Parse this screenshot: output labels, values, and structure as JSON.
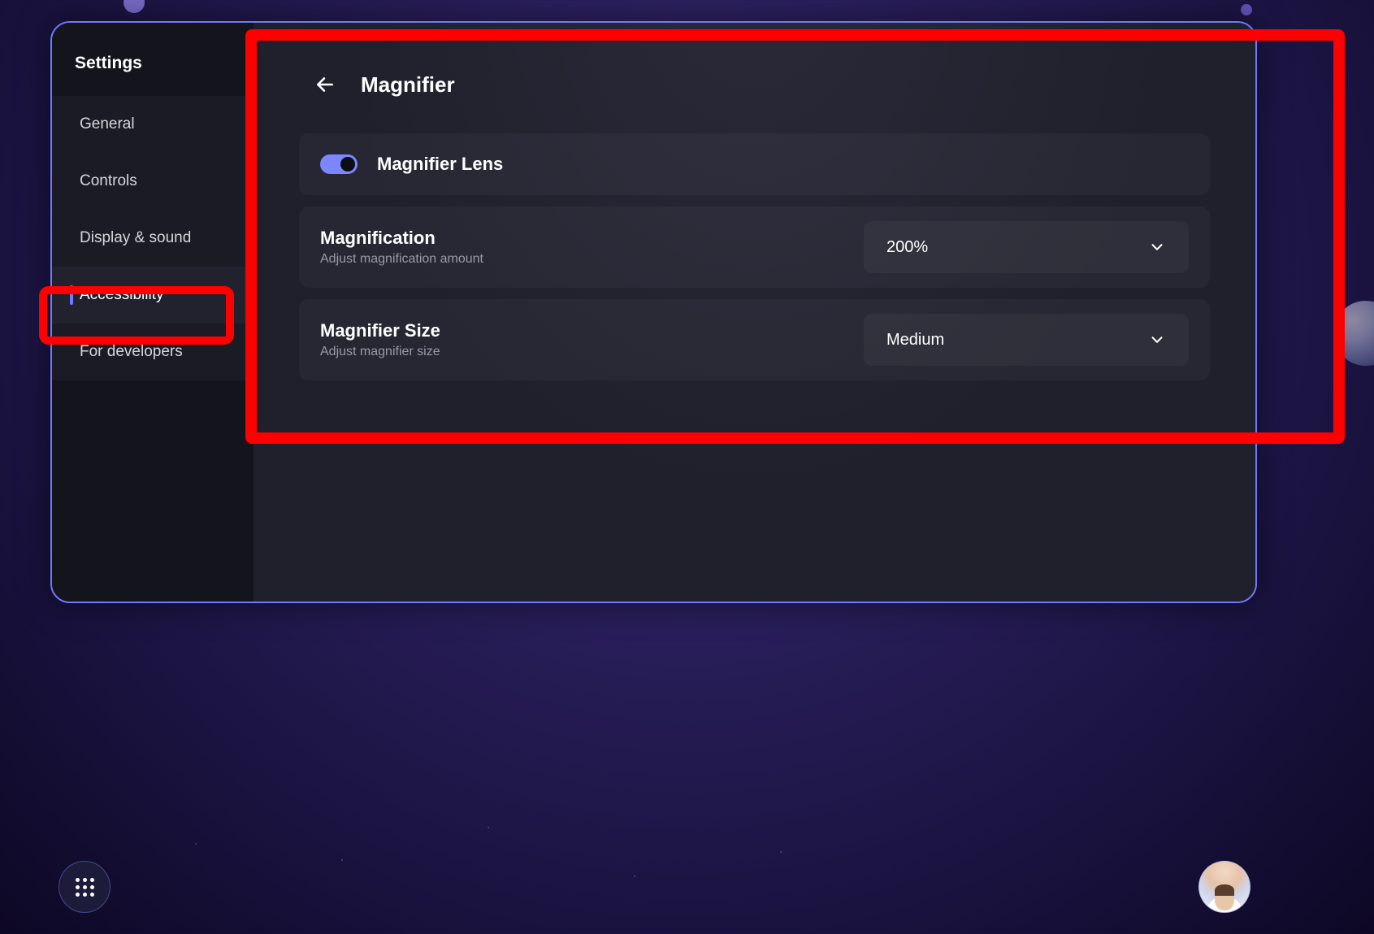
{
  "sidebar": {
    "title": "Settings",
    "items": [
      {
        "label": "General"
      },
      {
        "label": "Controls"
      },
      {
        "label": "Display & sound"
      },
      {
        "label": "Accessibility"
      },
      {
        "label": "For developers"
      }
    ],
    "active_index": 3
  },
  "page": {
    "title": "Magnifier"
  },
  "settings": {
    "magnifier_lens": {
      "label": "Magnifier Lens",
      "enabled": true
    },
    "magnification": {
      "title": "Magnification",
      "subtitle": "Adjust magnification amount",
      "value": "200%"
    },
    "magnifier_size": {
      "title": "Magnifier Size",
      "subtitle": "Adjust magnifier size",
      "value": "Medium"
    }
  },
  "colors": {
    "accent": "#6e7aff",
    "highlight": "#ff0000"
  }
}
